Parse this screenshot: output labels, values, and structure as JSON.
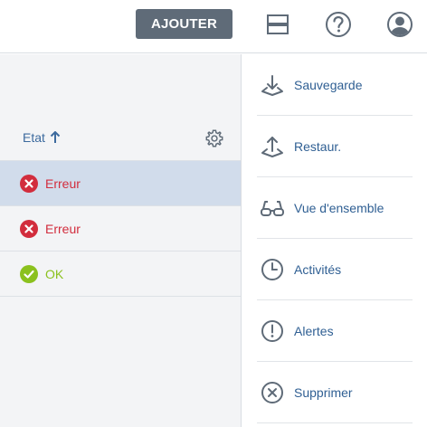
{
  "toolbar": {
    "add_label": "AJOUTER",
    "icons": [
      "layout-toggle-icon",
      "help-icon",
      "user-account-icon"
    ]
  },
  "list": {
    "sort_label": "Etat",
    "sort_direction": "ascending",
    "rows": [
      {
        "status": "error",
        "label": "Erreur",
        "selected": true
      },
      {
        "status": "error",
        "label": "Erreur",
        "selected": false
      },
      {
        "status": "ok",
        "label": "OK",
        "selected": false
      }
    ]
  },
  "menu": {
    "items": [
      {
        "label": "Sauvegarde",
        "icon": "download-icon"
      },
      {
        "label": "Restaur.",
        "icon": "upload-icon"
      },
      {
        "label": "Vue d'ensemble",
        "icon": "glasses-icon"
      },
      {
        "label": "Activités",
        "icon": "clock-icon"
      },
      {
        "label": "Alertes",
        "icon": "alert-icon"
      },
      {
        "label": "Supprimer",
        "icon": "delete-icon"
      }
    ]
  },
  "colors": {
    "accent": "#2f5f93",
    "error": "#d22d3d",
    "ok": "#8bc11e",
    "button": "#5f6b78",
    "selected_row": "#d1dceb"
  }
}
